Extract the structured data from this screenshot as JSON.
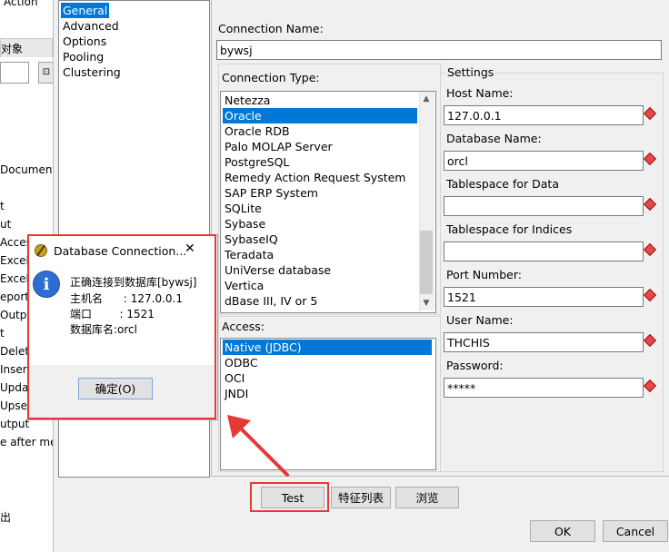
{
  "background_app": {
    "menu_action": "Action",
    "tab_label": "对象",
    "tree_items": [
      "Document",
      "t",
      "ut",
      "Acces",
      "Excel",
      "Excel",
      "eporti",
      "Outp",
      "t",
      "Delet",
      "Inser",
      "Upda",
      "Upse",
      "utput",
      "e after me",
      "出"
    ]
  },
  "nav": {
    "items": [
      "General",
      "Advanced",
      "Options",
      "Pooling",
      "Clustering"
    ],
    "selected": "General"
  },
  "connection": {
    "name_label": "Connection Name:",
    "name_value": "bywsj",
    "type_label": "Connection Type:",
    "types": [
      "Netezza",
      "Oracle",
      "Oracle RDB",
      "Palo MOLAP Server",
      "PostgreSQL",
      "Remedy Action Request System",
      "SAP ERP System",
      "SQLite",
      "Sybase",
      "SybaseIQ",
      "Teradata",
      "UniVerse database",
      "Vertica",
      "dBase III, IV or 5"
    ],
    "selected_type": "Oracle",
    "access_label": "Access:",
    "access": [
      "Native (JDBC)",
      "ODBC",
      "OCI",
      "JNDI"
    ],
    "selected_access": "Native (JDBC)"
  },
  "settings": {
    "title": "Settings",
    "host_label": "Host Name:",
    "host_value": "127.0.0.1",
    "db_label": "Database Name:",
    "db_value": "orcl",
    "ts_data_label": "Tablespace for Data",
    "ts_data_value": "",
    "ts_index_label": "Tablespace for Indices",
    "ts_index_value": "",
    "port_label": "Port Number:",
    "port_value": "1521",
    "user_label": "User Name:",
    "user_value": "THCHIS",
    "pass_label": "Password:",
    "pass_value": "*****"
  },
  "buttons": {
    "test": "Test",
    "features": "特征列表",
    "browse": "浏览",
    "ok": "OK",
    "cancel": "Cancel"
  },
  "popup": {
    "title": "Database Connection...",
    "close": "✕",
    "line1": "正确连接到数据库[bywsj]",
    "line2": "主机名      : 127.0.0.1",
    "line3": "端口        : 1521",
    "line4": "数据库名:orcl",
    "ok_button": "确定(O)",
    "info_glyph": "i"
  },
  "colors": {
    "highlight": "#e53935",
    "selection": "#0078d7"
  }
}
